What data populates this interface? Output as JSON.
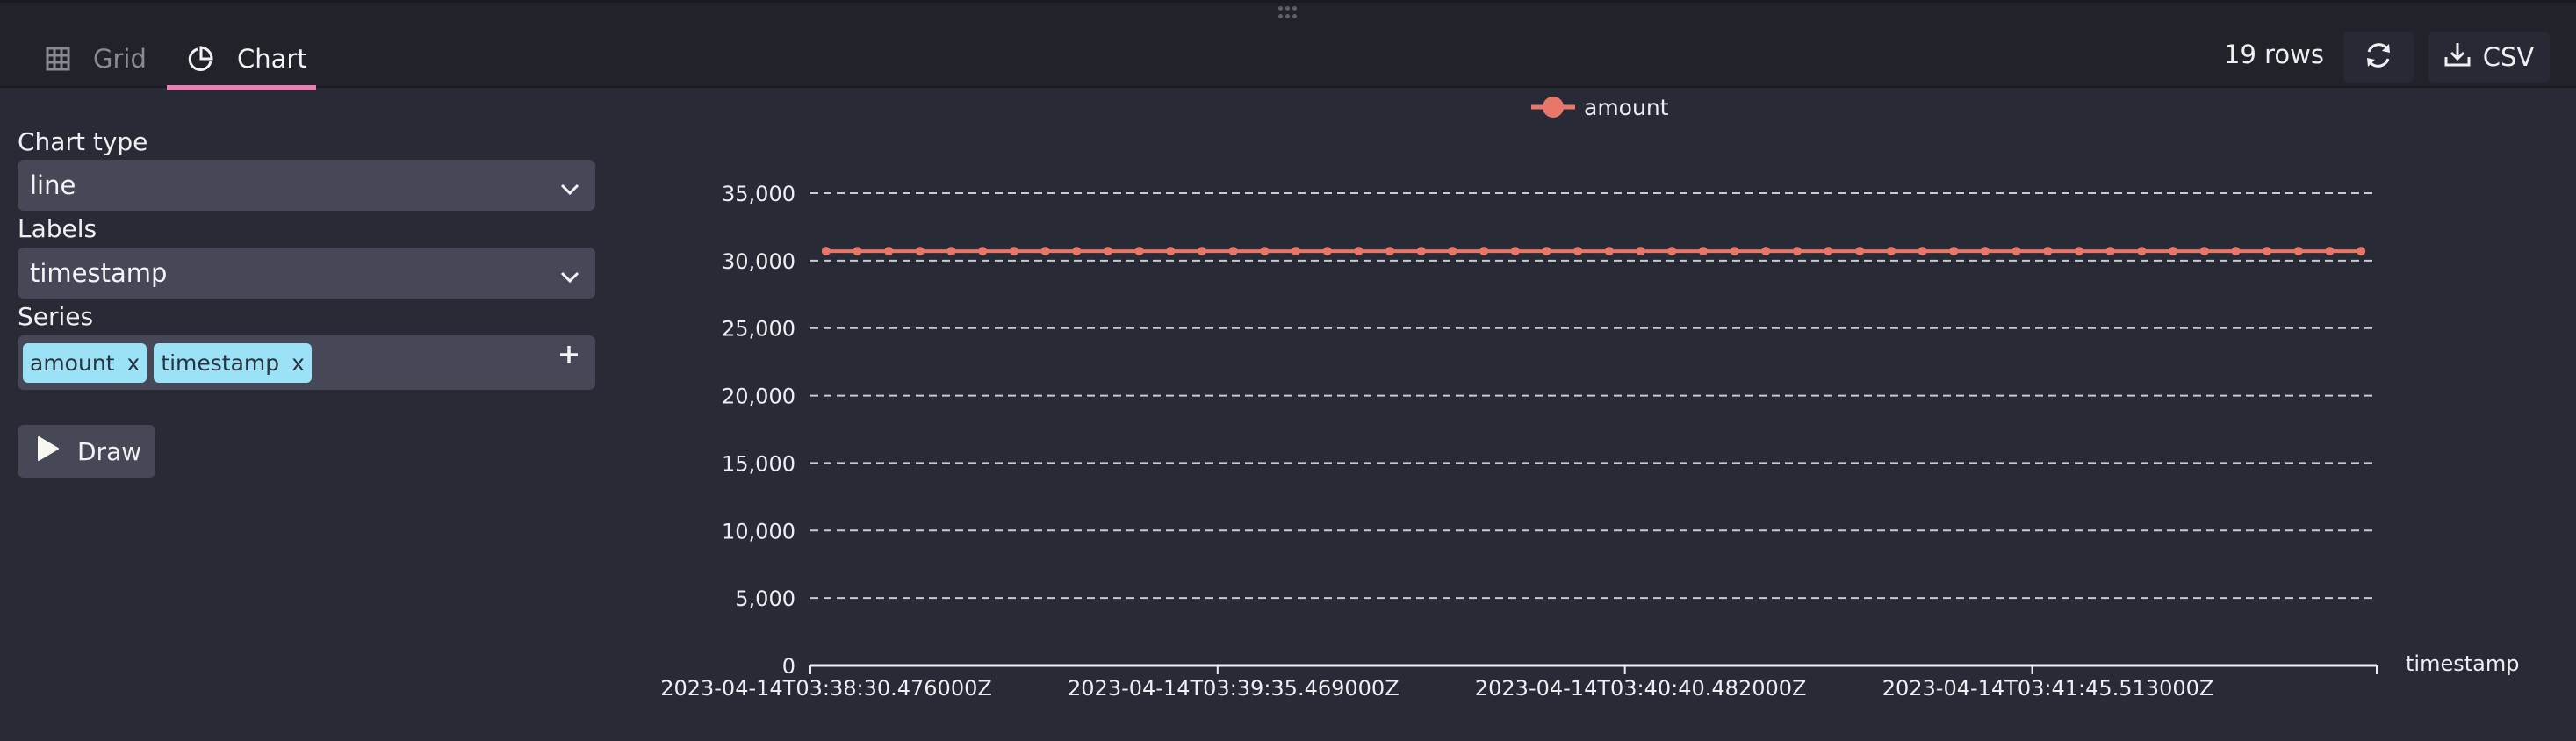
{
  "tabs": [
    {
      "label": "Grid",
      "icon": "grid-icon",
      "active": false
    },
    {
      "label": "Chart",
      "icon": "pie-chart-icon",
      "active": true
    }
  ],
  "toolbar": {
    "rows_count": "19 rows",
    "refresh_icon": "refresh-icon",
    "csv_label": "CSV",
    "csv_icon": "download-icon"
  },
  "form": {
    "chart_type_label": "Chart type",
    "chart_type_value": "line",
    "labels_label": "Labels",
    "labels_value": "timestamp",
    "series_label": "Series",
    "series_chips": [
      "amount",
      "timestamp"
    ],
    "chip_remove": "x",
    "draw_label": "Draw"
  },
  "colors": {
    "accent_tab": "#ea7fb3",
    "series": "#e8776a",
    "chip": "#9ce2f6"
  },
  "chart_data": {
    "type": "line",
    "title": "",
    "legend": [
      "amount"
    ],
    "legend_position": "top-center",
    "xlabel": "timestamp",
    "ylabel": "",
    "ylim": [
      0,
      35000
    ],
    "yticks": [
      0,
      5000,
      10000,
      15000,
      20000,
      25000,
      30000,
      35000
    ],
    "ytick_labels": [
      "0",
      "5,000",
      "10,000",
      "15,000",
      "20,000",
      "25,000",
      "30,000",
      "35,000"
    ],
    "grid": true,
    "point_count": 50,
    "xtick_labels": [
      {
        "index": 0,
        "label": "2023-04-14T03:38:30.476000Z"
      },
      {
        "index": 13,
        "label": "2023-04-14T03:39:35.469000Z"
      },
      {
        "index": 26,
        "label": "2023-04-14T03:40:40.482000Z"
      },
      {
        "index": 39,
        "label": "2023-04-14T03:41:45.513000Z"
      }
    ],
    "series": [
      {
        "name": "amount",
        "constant_value": 30700,
        "note": "approx. constant across all 50 points"
      }
    ]
  }
}
